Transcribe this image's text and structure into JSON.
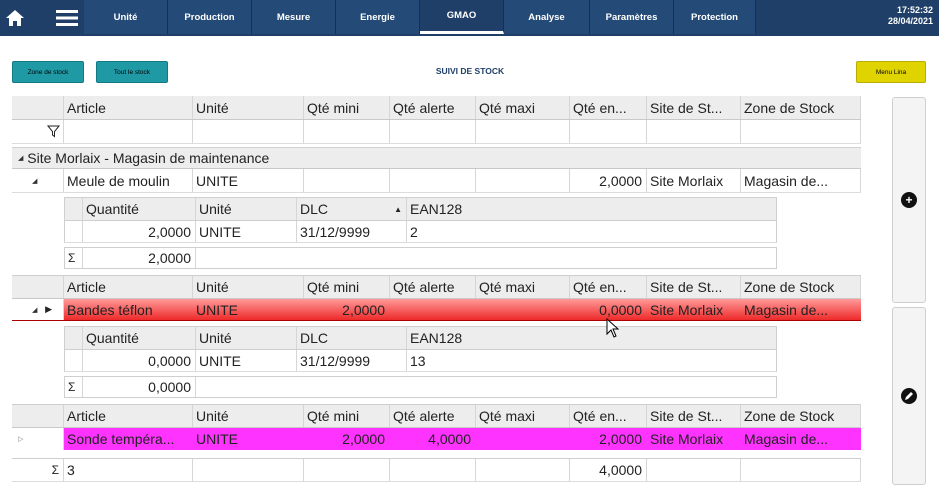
{
  "nav": {
    "tabs": [
      "Unité",
      "Production",
      "Mesure",
      "Energie",
      "GMAO",
      "Analyse",
      "Paramètres",
      "Protection"
    ],
    "active": "GMAO",
    "time": "17:52:32",
    "date": "28/04/2021"
  },
  "toolbar": {
    "zone_label": "Zone de stock",
    "tout_label": "Tout le stock",
    "title": "SUIVI DE STOCK",
    "menu_lina_label": "Menu Lina"
  },
  "grid": {
    "headers": [
      "Article",
      "Unité",
      "Qté mini",
      "Qté alerte",
      "Qté maxi",
      "Qté en...",
      "Site de St...",
      "Zone de Stock"
    ],
    "group": "Site Morlaix - Magasin de maintenance",
    "items": [
      {
        "article": "Meule de moulin",
        "unite": "UNITE",
        "mini": "",
        "alerte": "",
        "maxi": "",
        "qte": "2,0000",
        "site": "Site Morlaix",
        "zone": "Magasin de...",
        "sub_headers": [
          "Quantité",
          "Unité",
          "DLC",
          "EAN128"
        ],
        "lots": [
          {
            "quantite": "2,0000",
            "unite": "UNITE",
            "dlc": "31/12/9999",
            "ean": "2"
          }
        ],
        "sum": "2,0000"
      },
      {
        "article": "Bandes téflon",
        "unite": "UNITE",
        "mini": "2,0000",
        "alerte": "",
        "maxi": "",
        "qte": "0,0000",
        "site": "Site Morlaix",
        "zone": "Magasin de...",
        "sub_headers": [
          "Quantité",
          "Unité",
          "DLC",
          "EAN128"
        ],
        "lots": [
          {
            "quantite": "0,0000",
            "unite": "UNITE",
            "dlc": "31/12/9999",
            "ean": "13"
          }
        ],
        "sum": "0,0000"
      },
      {
        "article": "Sonde tempéra...",
        "unite": "UNITE",
        "mini": "2,0000",
        "alerte": "4,0000",
        "maxi": "",
        "qte": "2,0000",
        "site": "Site Morlaix",
        "zone": "Magasin de..."
      }
    ],
    "footer_count": "3",
    "footer_total": "4,0000",
    "sigma": "Σ"
  },
  "colors": {
    "nav_bg": "#1f3f68",
    "teal_button": "#1f9aa5",
    "yellow_button": "#e0d400",
    "alert_row": "#ee2a2a",
    "magenta_row": "#ff33ff"
  },
  "icons": [
    "home-icon",
    "hamburger-menu-icon",
    "filter-icon",
    "add-circle-icon",
    "edit-pencil-icon",
    "sort-up-icon"
  ]
}
